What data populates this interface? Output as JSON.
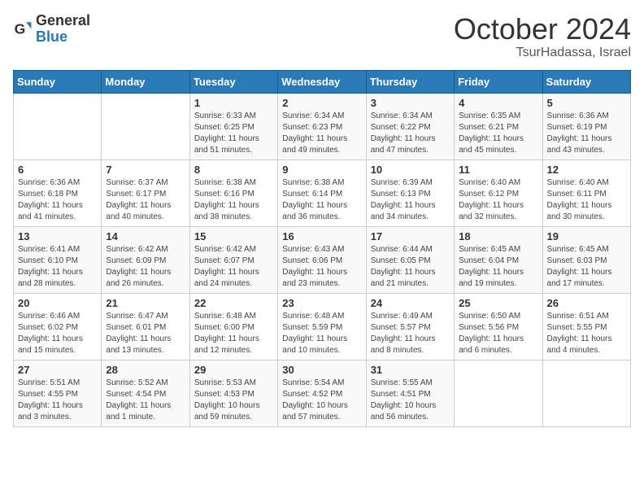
{
  "header": {
    "logo_general": "General",
    "logo_blue": "Blue",
    "month_title": "October 2024",
    "location": "TsurHadassa, Israel"
  },
  "days_of_week": [
    "Sunday",
    "Monday",
    "Tuesday",
    "Wednesday",
    "Thursday",
    "Friday",
    "Saturday"
  ],
  "weeks": [
    [
      {
        "day": "",
        "info": ""
      },
      {
        "day": "",
        "info": ""
      },
      {
        "day": "1",
        "info": "Sunrise: 6:33 AM\nSunset: 6:25 PM\nDaylight: 11 hours and 51 minutes."
      },
      {
        "day": "2",
        "info": "Sunrise: 6:34 AM\nSunset: 6:23 PM\nDaylight: 11 hours and 49 minutes."
      },
      {
        "day": "3",
        "info": "Sunrise: 6:34 AM\nSunset: 6:22 PM\nDaylight: 11 hours and 47 minutes."
      },
      {
        "day": "4",
        "info": "Sunrise: 6:35 AM\nSunset: 6:21 PM\nDaylight: 11 hours and 45 minutes."
      },
      {
        "day": "5",
        "info": "Sunrise: 6:36 AM\nSunset: 6:19 PM\nDaylight: 11 hours and 43 minutes."
      }
    ],
    [
      {
        "day": "6",
        "info": "Sunrise: 6:36 AM\nSunset: 6:18 PM\nDaylight: 11 hours and 41 minutes."
      },
      {
        "day": "7",
        "info": "Sunrise: 6:37 AM\nSunset: 6:17 PM\nDaylight: 11 hours and 40 minutes."
      },
      {
        "day": "8",
        "info": "Sunrise: 6:38 AM\nSunset: 6:16 PM\nDaylight: 11 hours and 38 minutes."
      },
      {
        "day": "9",
        "info": "Sunrise: 6:38 AM\nSunset: 6:14 PM\nDaylight: 11 hours and 36 minutes."
      },
      {
        "day": "10",
        "info": "Sunrise: 6:39 AM\nSunset: 6:13 PM\nDaylight: 11 hours and 34 minutes."
      },
      {
        "day": "11",
        "info": "Sunrise: 6:40 AM\nSunset: 6:12 PM\nDaylight: 11 hours and 32 minutes."
      },
      {
        "day": "12",
        "info": "Sunrise: 6:40 AM\nSunset: 6:11 PM\nDaylight: 11 hours and 30 minutes."
      }
    ],
    [
      {
        "day": "13",
        "info": "Sunrise: 6:41 AM\nSunset: 6:10 PM\nDaylight: 11 hours and 28 minutes."
      },
      {
        "day": "14",
        "info": "Sunrise: 6:42 AM\nSunset: 6:09 PM\nDaylight: 11 hours and 26 minutes."
      },
      {
        "day": "15",
        "info": "Sunrise: 6:42 AM\nSunset: 6:07 PM\nDaylight: 11 hours and 24 minutes."
      },
      {
        "day": "16",
        "info": "Sunrise: 6:43 AM\nSunset: 6:06 PM\nDaylight: 11 hours and 23 minutes."
      },
      {
        "day": "17",
        "info": "Sunrise: 6:44 AM\nSunset: 6:05 PM\nDaylight: 11 hours and 21 minutes."
      },
      {
        "day": "18",
        "info": "Sunrise: 6:45 AM\nSunset: 6:04 PM\nDaylight: 11 hours and 19 minutes."
      },
      {
        "day": "19",
        "info": "Sunrise: 6:45 AM\nSunset: 6:03 PM\nDaylight: 11 hours and 17 minutes."
      }
    ],
    [
      {
        "day": "20",
        "info": "Sunrise: 6:46 AM\nSunset: 6:02 PM\nDaylight: 11 hours and 15 minutes."
      },
      {
        "day": "21",
        "info": "Sunrise: 6:47 AM\nSunset: 6:01 PM\nDaylight: 11 hours and 13 minutes."
      },
      {
        "day": "22",
        "info": "Sunrise: 6:48 AM\nSunset: 6:00 PM\nDaylight: 11 hours and 12 minutes."
      },
      {
        "day": "23",
        "info": "Sunrise: 6:48 AM\nSunset: 5:59 PM\nDaylight: 11 hours and 10 minutes."
      },
      {
        "day": "24",
        "info": "Sunrise: 6:49 AM\nSunset: 5:57 PM\nDaylight: 11 hours and 8 minutes."
      },
      {
        "day": "25",
        "info": "Sunrise: 6:50 AM\nSunset: 5:56 PM\nDaylight: 11 hours and 6 minutes."
      },
      {
        "day": "26",
        "info": "Sunrise: 6:51 AM\nSunset: 5:55 PM\nDaylight: 11 hours and 4 minutes."
      }
    ],
    [
      {
        "day": "27",
        "info": "Sunrise: 5:51 AM\nSunset: 4:55 PM\nDaylight: 11 hours and 3 minutes."
      },
      {
        "day": "28",
        "info": "Sunrise: 5:52 AM\nSunset: 4:54 PM\nDaylight: 11 hours and 1 minute."
      },
      {
        "day": "29",
        "info": "Sunrise: 5:53 AM\nSunset: 4:53 PM\nDaylight: 10 hours and 59 minutes."
      },
      {
        "day": "30",
        "info": "Sunrise: 5:54 AM\nSunset: 4:52 PM\nDaylight: 10 hours and 57 minutes."
      },
      {
        "day": "31",
        "info": "Sunrise: 5:55 AM\nSunset: 4:51 PM\nDaylight: 10 hours and 56 minutes."
      },
      {
        "day": "",
        "info": ""
      },
      {
        "day": "",
        "info": ""
      }
    ]
  ]
}
